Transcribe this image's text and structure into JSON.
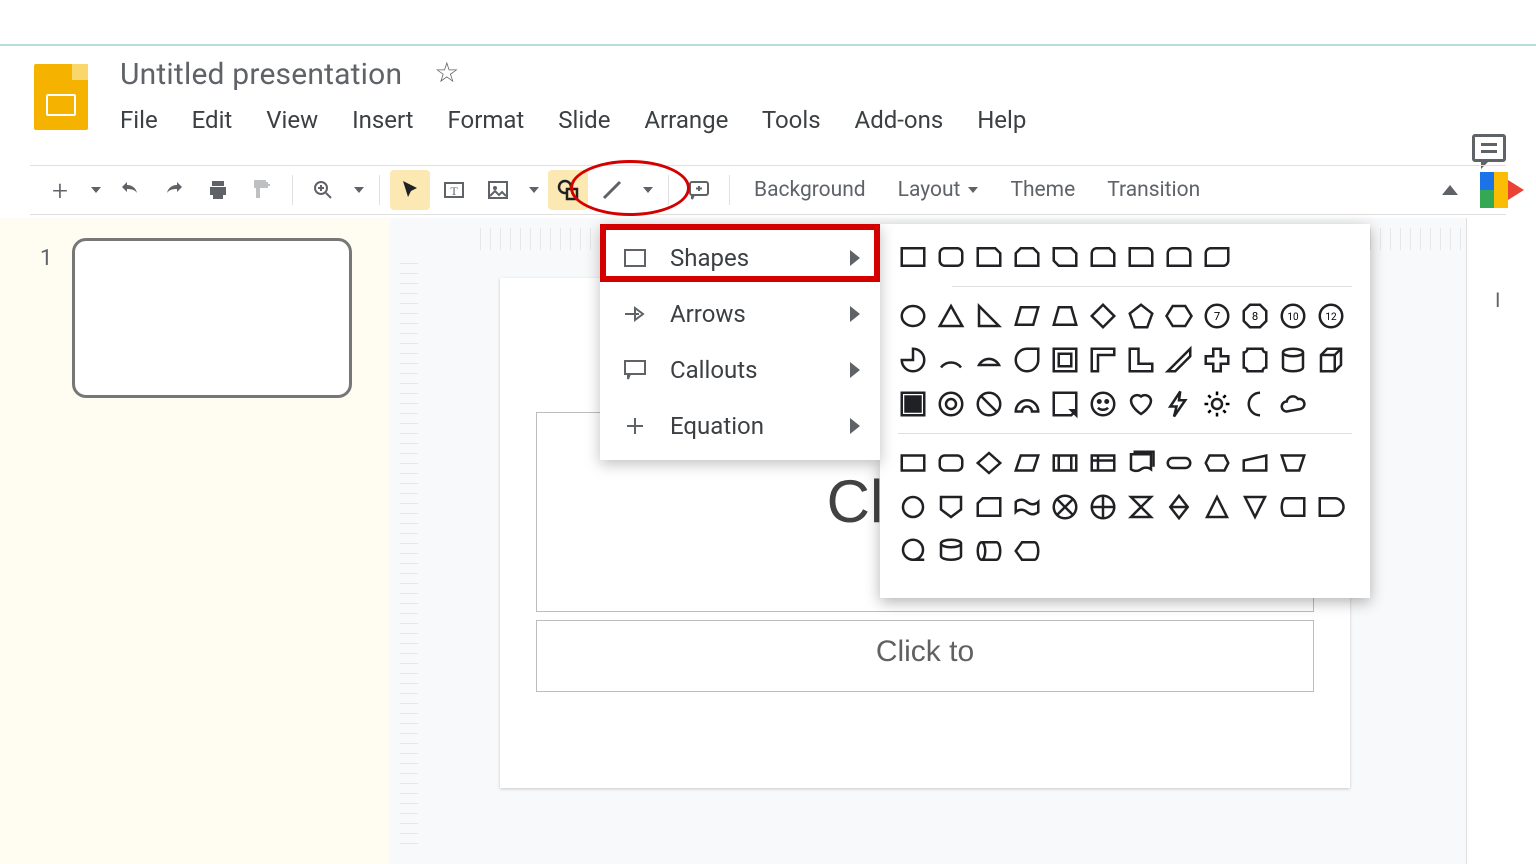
{
  "doc": {
    "title": "Untitled presentation"
  },
  "menubar": {
    "file": "File",
    "edit": "Edit",
    "view": "View",
    "insert": "Insert",
    "format": "Format",
    "slide": "Slide",
    "arrange": "Arrange",
    "tools": "Tools",
    "addons": "Add-ons",
    "help": "Help"
  },
  "toolbar": {
    "background": "Background",
    "layout": "Layout",
    "theme": "Theme",
    "transition": "Transition"
  },
  "filmstrip": {
    "slide1_num": "1"
  },
  "slide": {
    "title_placeholder": "Click to",
    "subtitle_placeholder": "Click to"
  },
  "shape_menu": {
    "shapes": "Shapes",
    "arrows": "Arrows",
    "callouts": "Callouts",
    "equation": "Equation"
  },
  "annotations": {
    "circled_tool": "shape-tool",
    "boxed_menu_item": "shapes"
  },
  "right_rail": {
    "label": "I"
  }
}
